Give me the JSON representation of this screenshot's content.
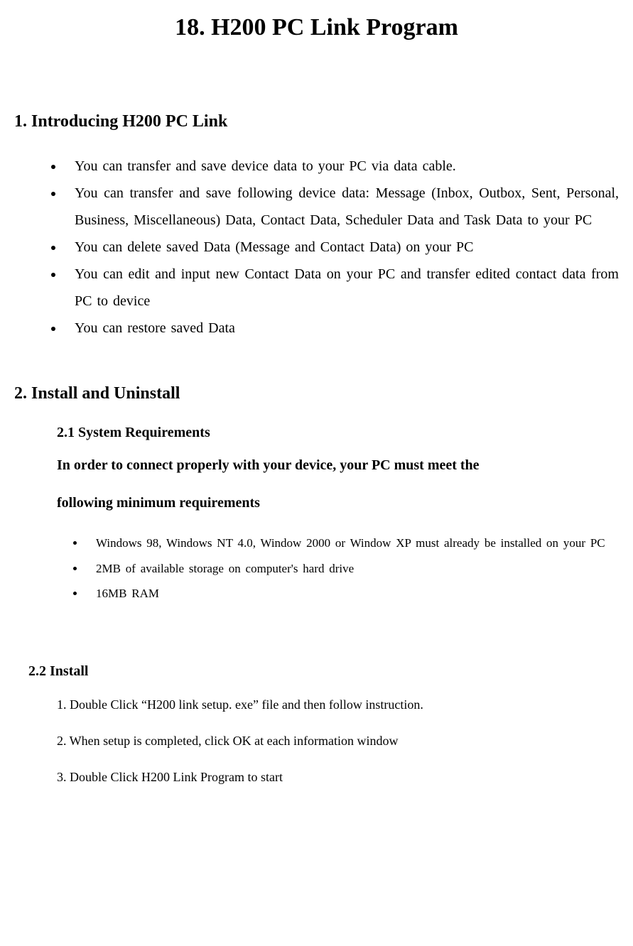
{
  "title": "18. H200 PC Link Program",
  "section1": {
    "heading": "1. Introducing H200 PC Link",
    "items": [
      "You can transfer and save device data to your PC via data cable.",
      "You can transfer and save following device data: Message (Inbox, Outbox, Sent, Personal, Business, Miscellaneous) Data, Contact Data, Scheduler Data and Task Data to your PC",
      "You can delete saved Data (Message and Contact Data) on your PC",
      "You can edit and input new Contact Data on your PC and transfer edited contact data from PC to device",
      "You can restore saved Data"
    ]
  },
  "section2": {
    "heading": "2. Install and Uninstall",
    "sub1": {
      "heading": "2.1 System Requirements",
      "intro1": "In order to connect properly with your device, your PC must meet the",
      "intro2": "following minimum requirements",
      "items": [
        "Windows 98, Windows NT 4.0, Window 2000 or Window XP must already be installed on your PC",
        "2MB of available storage on computer's hard drive",
        "16MB RAM"
      ]
    },
    "sub2": {
      "heading": "2.2 Install",
      "steps": [
        "1. Double Click “H200 link setup. exe” file and then follow instruction.",
        "2. When setup is completed, click OK at each information window",
        "3. Double Click H200 Link Program to start"
      ]
    }
  }
}
